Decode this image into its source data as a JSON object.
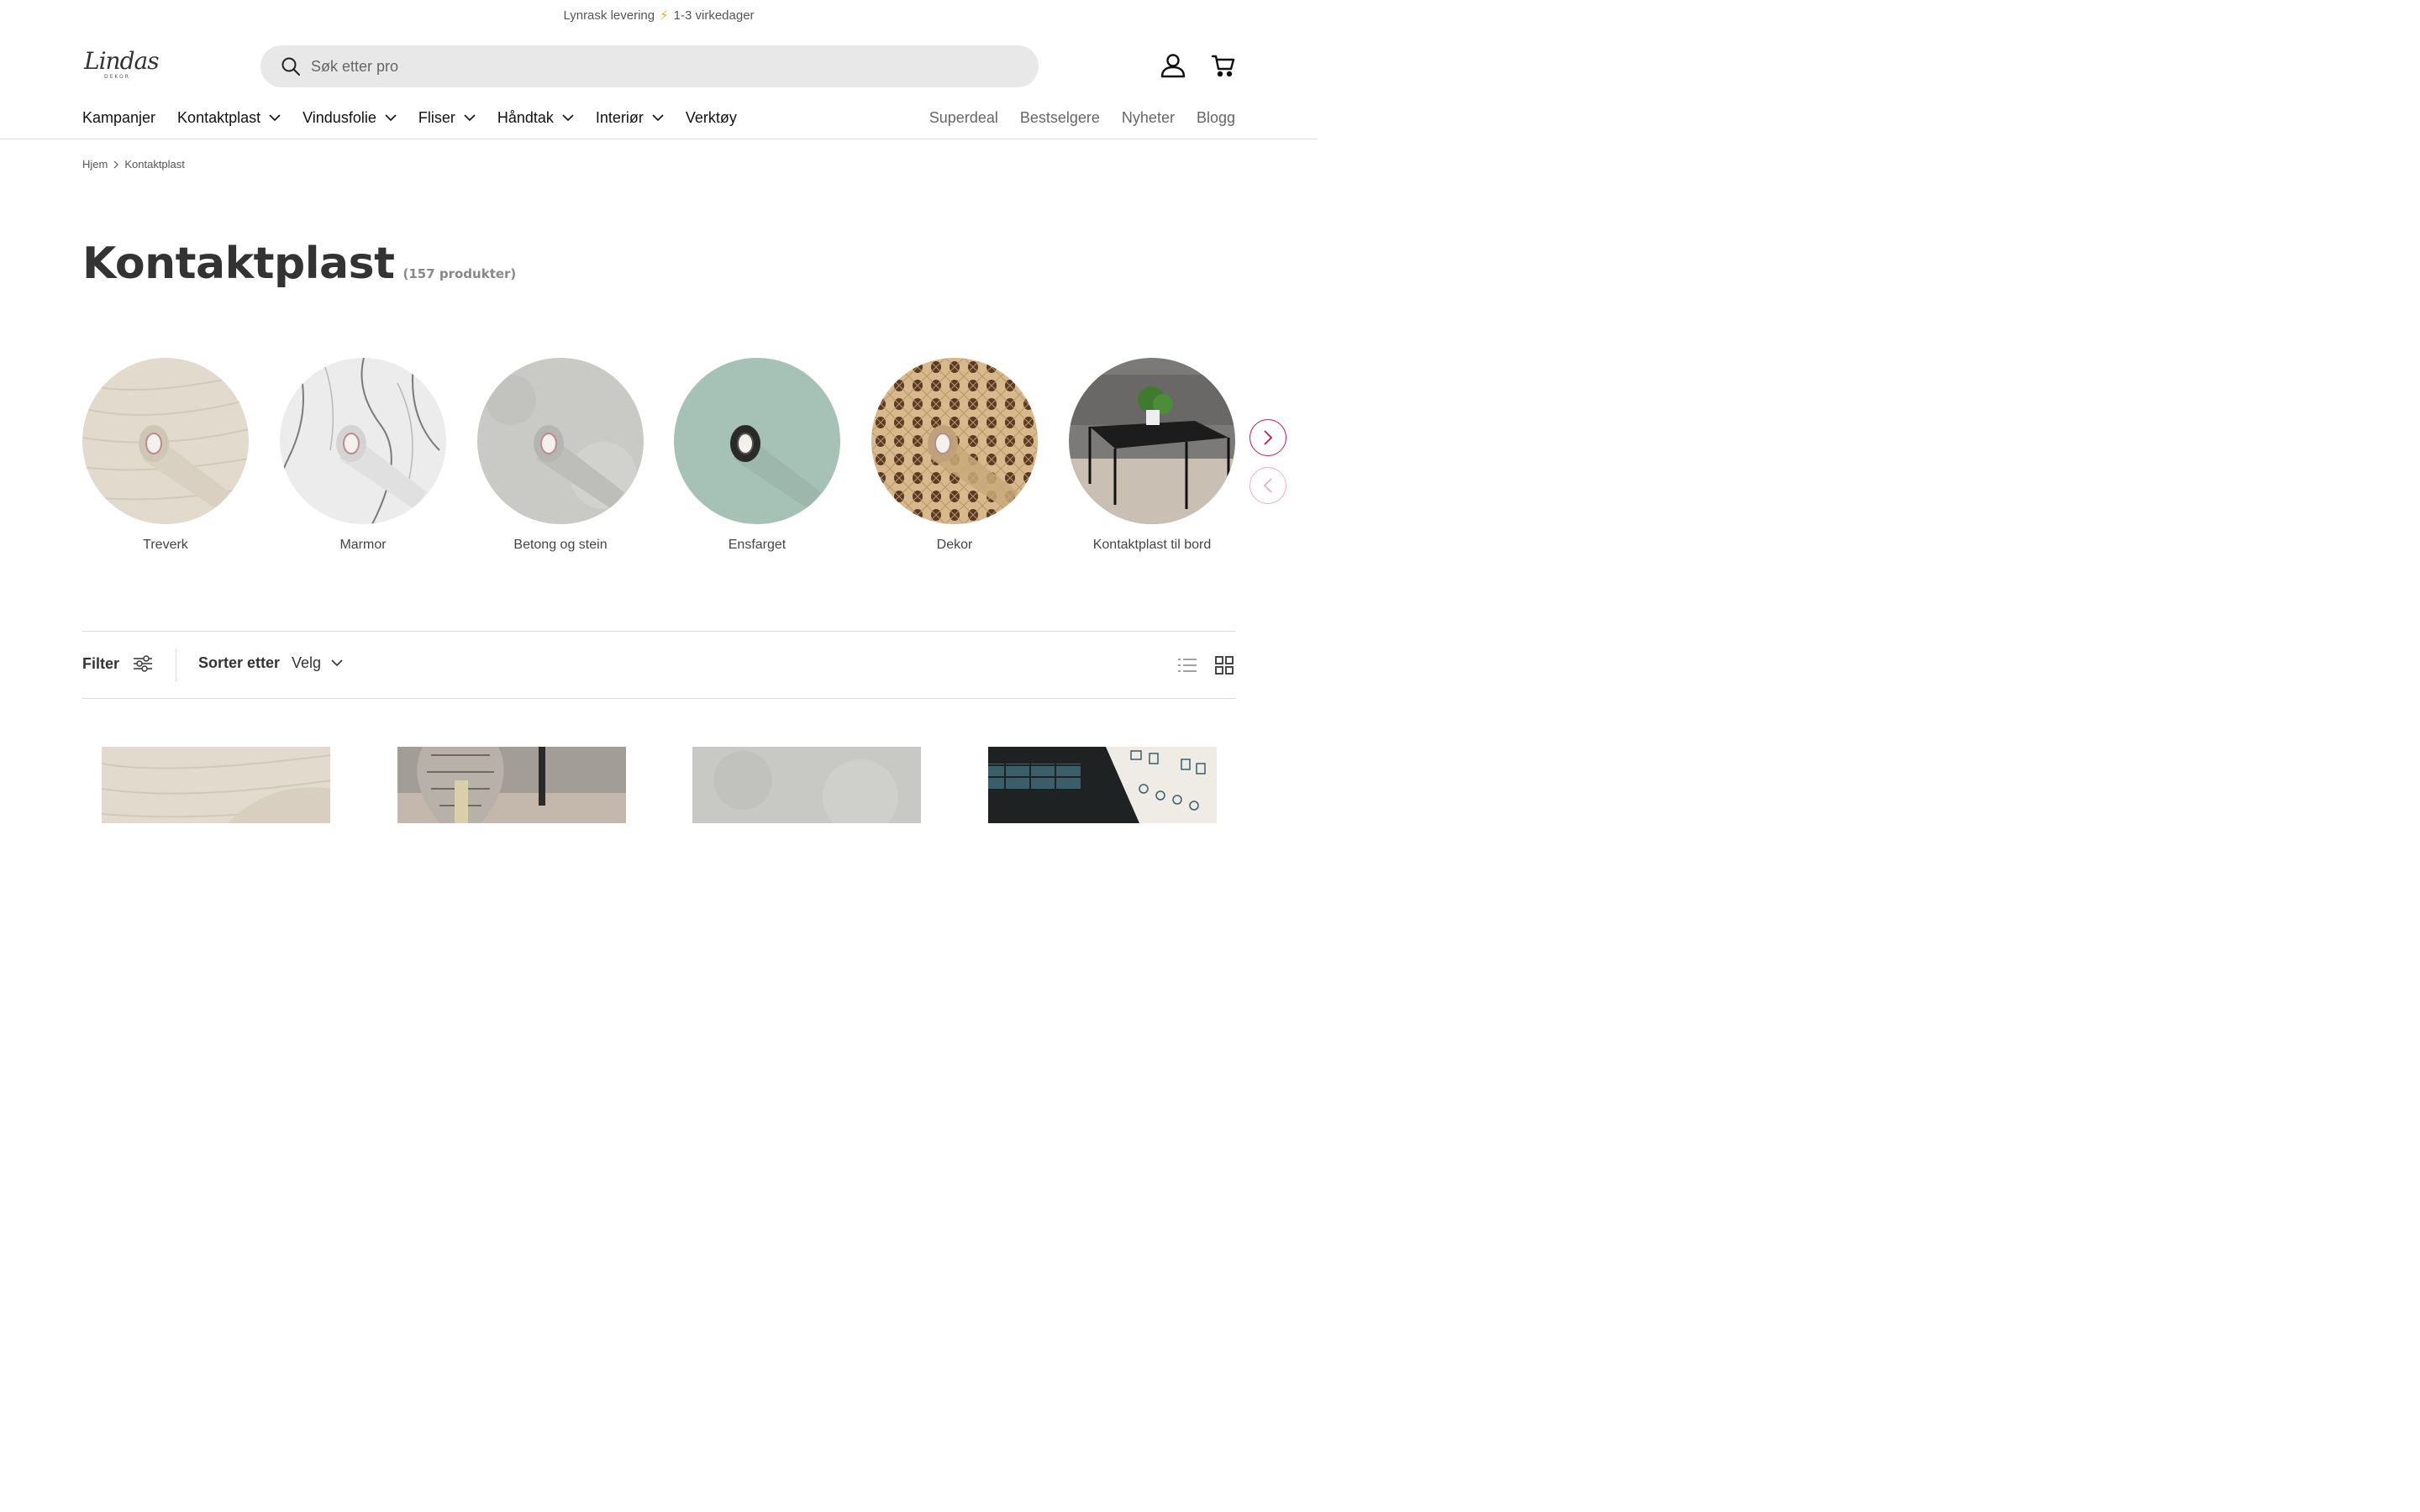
{
  "announcement": {
    "text_before": "Lynrask levering",
    "bolt": "⚡",
    "text_after": "1-3 virkedager"
  },
  "logo": {
    "script": "Lindas",
    "sub": "DEKOR"
  },
  "search": {
    "placeholder": "Søk etter pro"
  },
  "icons": {
    "search": "search-icon",
    "account": "user-icon",
    "cart": "cart-icon",
    "filter": "sliders-icon",
    "list_view": "list-icon",
    "grid_view": "grid-icon"
  },
  "nav": {
    "items": [
      {
        "label": "Kampanjer",
        "has_dropdown": false
      },
      {
        "label": "Kontaktplast",
        "has_dropdown": true
      },
      {
        "label": "Vindusfolie",
        "has_dropdown": true
      },
      {
        "label": "Fliser",
        "has_dropdown": true
      },
      {
        "label": "Håndtak",
        "has_dropdown": true
      },
      {
        "label": "Interiør",
        "has_dropdown": true
      },
      {
        "label": "Verktøy",
        "has_dropdown": false
      }
    ],
    "secondary": [
      "Superdeal",
      "Bestselgere",
      "Nyheter",
      "Blogg"
    ]
  },
  "breadcrumb": {
    "home": "Hjem",
    "current": "Kontaktplast"
  },
  "page": {
    "title": "Kontaktplast",
    "count": "(157 produkter)"
  },
  "collections": [
    {
      "label": "Treverk"
    },
    {
      "label": "Marmor"
    },
    {
      "label": "Betong og stein"
    },
    {
      "label": "Ensfarget"
    },
    {
      "label": "Dekor"
    },
    {
      "label": "Kontaktplast til bord"
    }
  ],
  "toolbar": {
    "filter_label": "Filter",
    "sort_label": "Sorter etter",
    "sort_value": "Velg"
  },
  "colors": {
    "accent": "#c2185b",
    "search_bg": "#e8e8e8",
    "border": "#dcdcdc"
  }
}
